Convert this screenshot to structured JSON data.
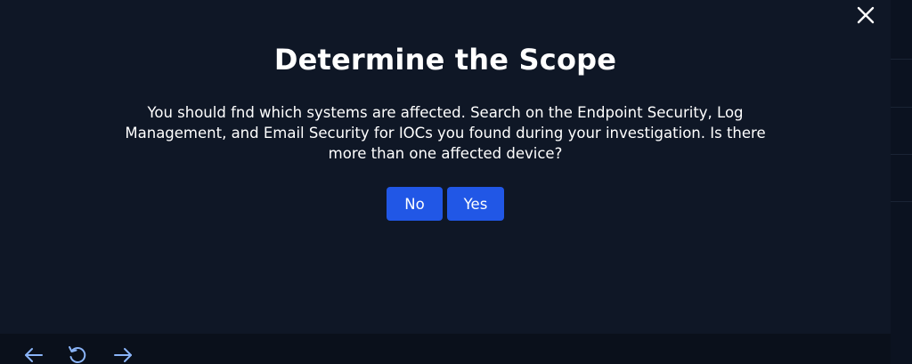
{
  "modal": {
    "title": "Determine the Scope",
    "body": "You should fnd which systems are affected. Search on the Endpoint Security, Log Management, and Email Security for IOCs you found during your investigation. Is there more than one affected device?",
    "close_icon": "close-icon",
    "buttons": {
      "no_label": "No",
      "yes_label": "Yes"
    }
  },
  "bottom_bar": {
    "icons": [
      "arrow-left-icon",
      "refresh-icon",
      "arrow-right-icon"
    ]
  },
  "colors": {
    "background": "#0f1726",
    "button": "#2157e6",
    "icon": "#8ab4f8",
    "text": "#ffffff"
  }
}
